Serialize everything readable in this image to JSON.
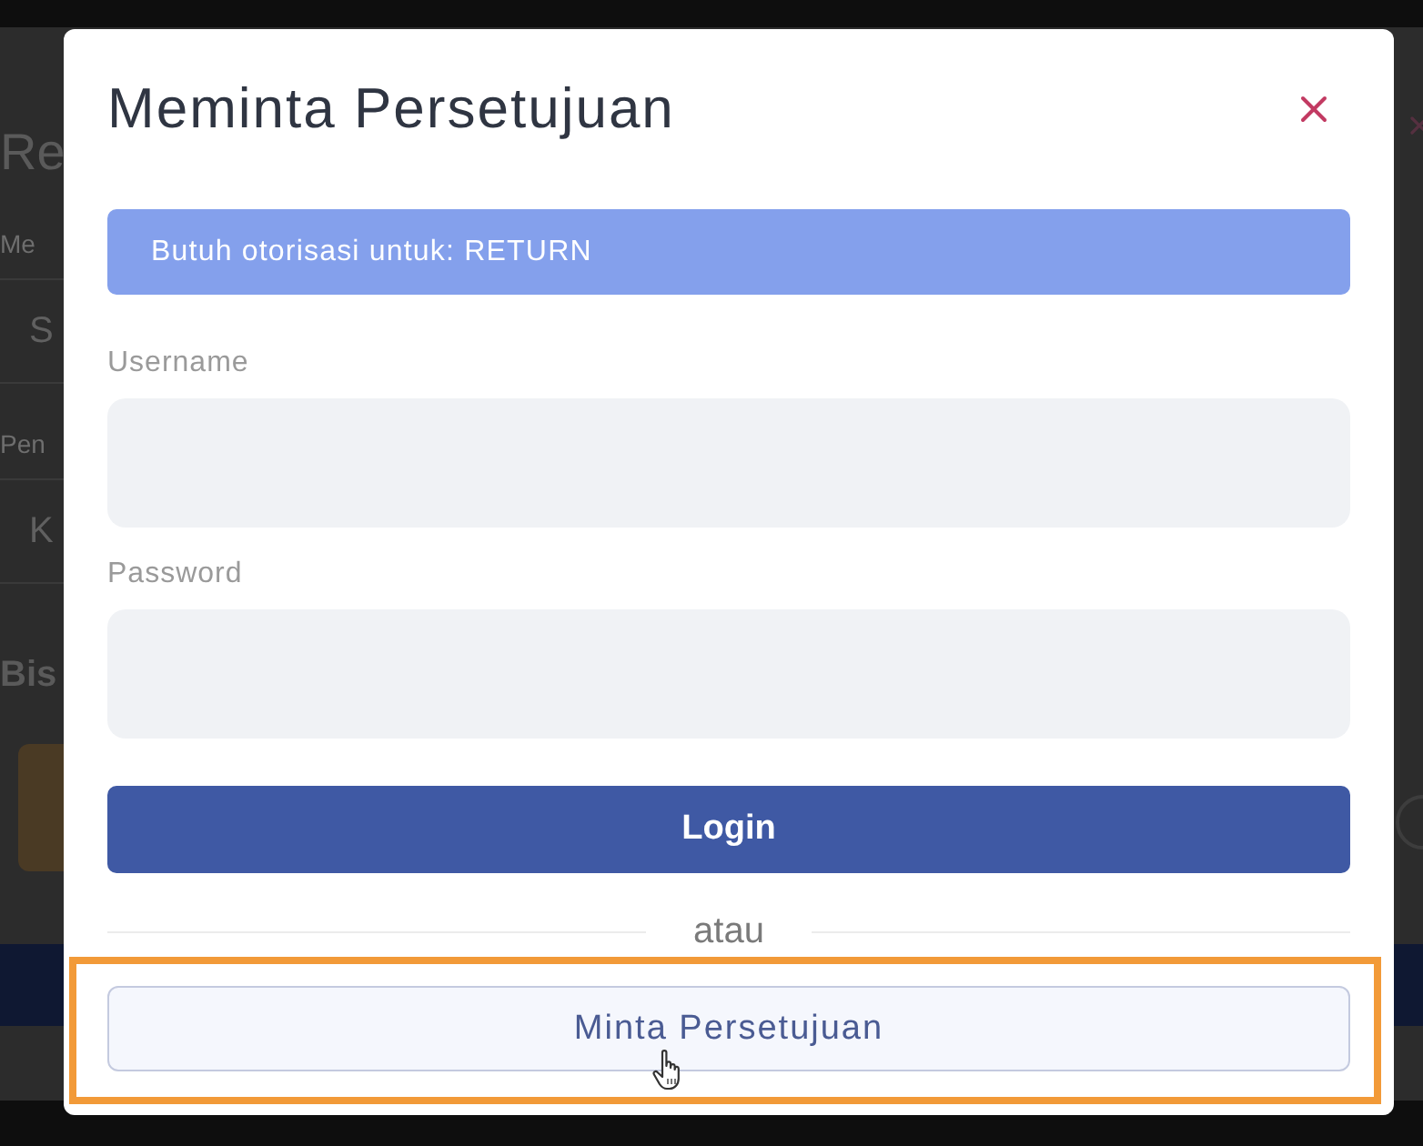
{
  "background_page": {
    "heading": "Re",
    "fields": [
      {
        "label": "Me",
        "value": "S"
      },
      {
        "label": "Pen",
        "value": "K"
      }
    ],
    "section_title": "Bis"
  },
  "dialog": {
    "title": "Meminta Persetujuan",
    "notice": "Butuh otorisasi untuk: RETURN",
    "fields": [
      {
        "label": "Username"
      },
      {
        "label": "Password"
      }
    ],
    "login_button": "Login",
    "separator": "atau",
    "request_button": "Minta Persetujuan"
  }
}
